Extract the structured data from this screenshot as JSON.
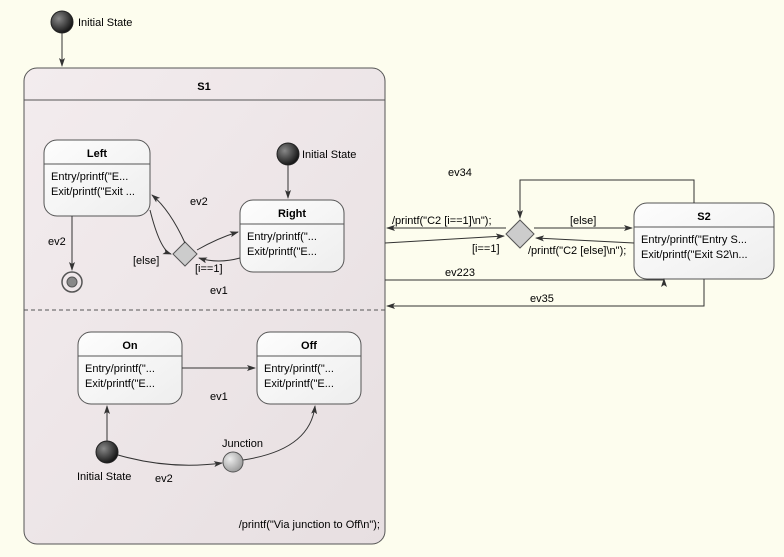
{
  "initial_outer": {
    "label": "Initial State"
  },
  "s1": {
    "title": "S1",
    "regionA": {
      "left": {
        "title": "Left",
        "entry": "Entry/printf(\"E...",
        "exit": "Exit/printf(\"Exit ..."
      },
      "right": {
        "title": "Right",
        "entry": "Entry/printf(\"...",
        "exit": "Exit/printf(\"E..."
      },
      "initial": {
        "label": "Initial State"
      },
      "edges": {
        "ev2_left_down": "ev2",
        "ev2_choice_to_left": "ev2",
        "ev1_right_to_choice": "ev1",
        "guard_i1": "[i==1]",
        "guard_else": "[else]"
      }
    },
    "regionB": {
      "on": {
        "title": "On",
        "entry": "Entry/printf(\"...",
        "exit": "Exit/printf(\"E..."
      },
      "off": {
        "title": "Off",
        "entry": "Entry/printf(\"...",
        "exit": "Exit/printf(\"E..."
      },
      "initial": {
        "label": "Initial State"
      },
      "junction": {
        "label": "Junction"
      },
      "edges": {
        "ev1_on_off": "ev1",
        "ev2_to_junction": "ev2",
        "junc_action": "/printf(\"Via junction to Off\\n\");"
      }
    }
  },
  "s2": {
    "title": "S2",
    "entry": "Entry/printf(\"Entry S...",
    "exit": "Exit/printf(\"Exit S2\\n..."
  },
  "choiceC2": {
    "ev34": "ev34",
    "ev223": "ev223",
    "ev35": "ev35",
    "action_i1": "/printf(\"C2 [i==1]\\n\");",
    "guard_i1": "[i==1]",
    "guard_else": "[else]",
    "action_else": "/printf(\"C2 [else]\\n\");"
  }
}
